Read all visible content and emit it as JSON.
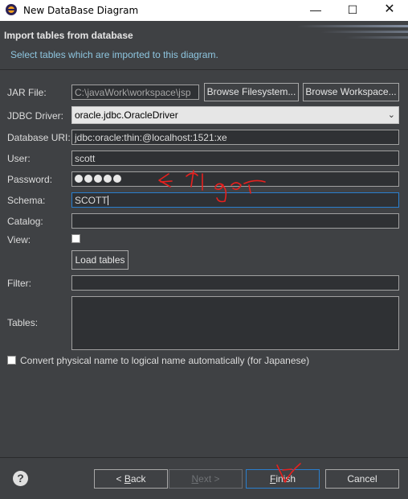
{
  "window": {
    "title": "New DataBase Diagram",
    "controls": {
      "minimize": "—",
      "maximize": "☐",
      "close": "✕"
    }
  },
  "header": {
    "title": "Import tables from database",
    "description": "Select tables which are imported to this diagram."
  },
  "form": {
    "jar_file": {
      "label": "JAR File:",
      "value": "C:\\javaWork\\workspace\\jsp",
      "browse_filesystem": "Browse Filesystem...",
      "browse_workspace": "Browse Workspace..."
    },
    "jdbc_driver": {
      "label": "JDBC Driver:",
      "value": "oracle.jdbc.OracleDriver"
    },
    "database_uri": {
      "label": "Database URI:",
      "value": "jdbc:oracle:thin:@localhost:1521:xe"
    },
    "user": {
      "label": "User:",
      "value": "scott"
    },
    "password": {
      "label": "Password:",
      "masked_length": 5
    },
    "schema": {
      "label": "Schema:",
      "value": "SCOTT"
    },
    "catalog": {
      "label": "Catalog:",
      "value": ""
    },
    "view": {
      "label": "View:",
      "checked": false
    },
    "load_tables": "Load tables",
    "filter": {
      "label": "Filter:",
      "value": ""
    },
    "tables": {
      "label": "Tables:"
    },
    "convert": {
      "label": "Convert physical name to logical name automatically (for Japanese)",
      "checked": false
    }
  },
  "footer": {
    "help": "?",
    "back": {
      "prefix": "< ",
      "mnemonic": "B",
      "rest": "ack"
    },
    "next": {
      "mnemonic": "N",
      "rest": "ext >"
    },
    "finish": {
      "mnemonic": "F",
      "rest": "inish"
    },
    "cancel": "Cancel"
  },
  "annotation": {
    "color": "#e8201e"
  }
}
